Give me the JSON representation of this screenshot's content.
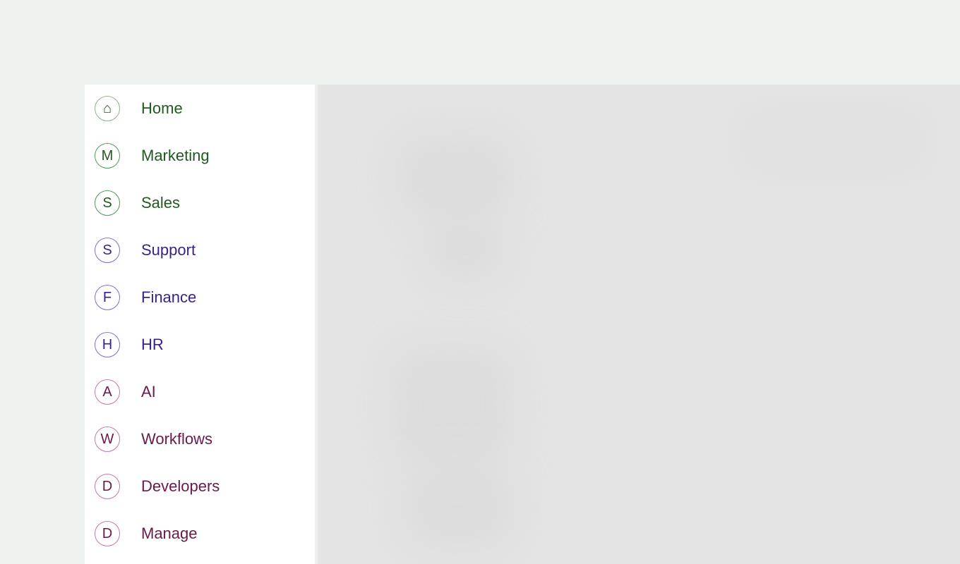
{
  "sidebar": {
    "items": [
      {
        "label": "Home",
        "icon": "⌂",
        "icon_name": "home-icon",
        "color": "#1f5a1f",
        "ring": "#8fb08f"
      },
      {
        "label": "Marketing",
        "icon": "M",
        "icon_name": "marketing-initial-icon",
        "color": "#1f5a1f",
        "ring": "#4f9a5a"
      },
      {
        "label": "Sales",
        "icon": "S",
        "icon_name": "sales-initial-icon",
        "color": "#1f5a1f",
        "ring": "#4f9a5a"
      },
      {
        "label": "Support",
        "icon": "S",
        "icon_name": "support-initial-icon",
        "color": "#3b1f8a",
        "ring": "#8a6ad0"
      },
      {
        "label": "Finance",
        "icon": "F",
        "icon_name": "finance-initial-icon",
        "color": "#3b1f8a",
        "ring": "#8a6ad0"
      },
      {
        "label": "HR",
        "icon": "H",
        "icon_name": "hr-initial-icon",
        "color": "#3b1f8a",
        "ring": "#8a6ad0"
      },
      {
        "label": "AI",
        "icon": "A",
        "icon_name": "ai-initial-icon",
        "color": "#6a1a4a",
        "ring": "#c07aa8"
      },
      {
        "label": "Workflows",
        "icon": "W",
        "icon_name": "workflows-initial-icon",
        "color": "#6a1a4a",
        "ring": "#c07aa8"
      },
      {
        "label": "Developers",
        "icon": "D",
        "icon_name": "developers-initial-icon",
        "color": "#6a1a4a",
        "ring": "#c07aa8"
      },
      {
        "label": "Manage",
        "icon": "D",
        "icon_name": "manage-initial-icon",
        "color": "#6a1a4a",
        "ring": "#c07aa8"
      }
    ]
  },
  "colors": {
    "background": "#eef2ee",
    "sidebar_bg": "#ffffff",
    "content_bg": "#e4e4e4"
  }
}
